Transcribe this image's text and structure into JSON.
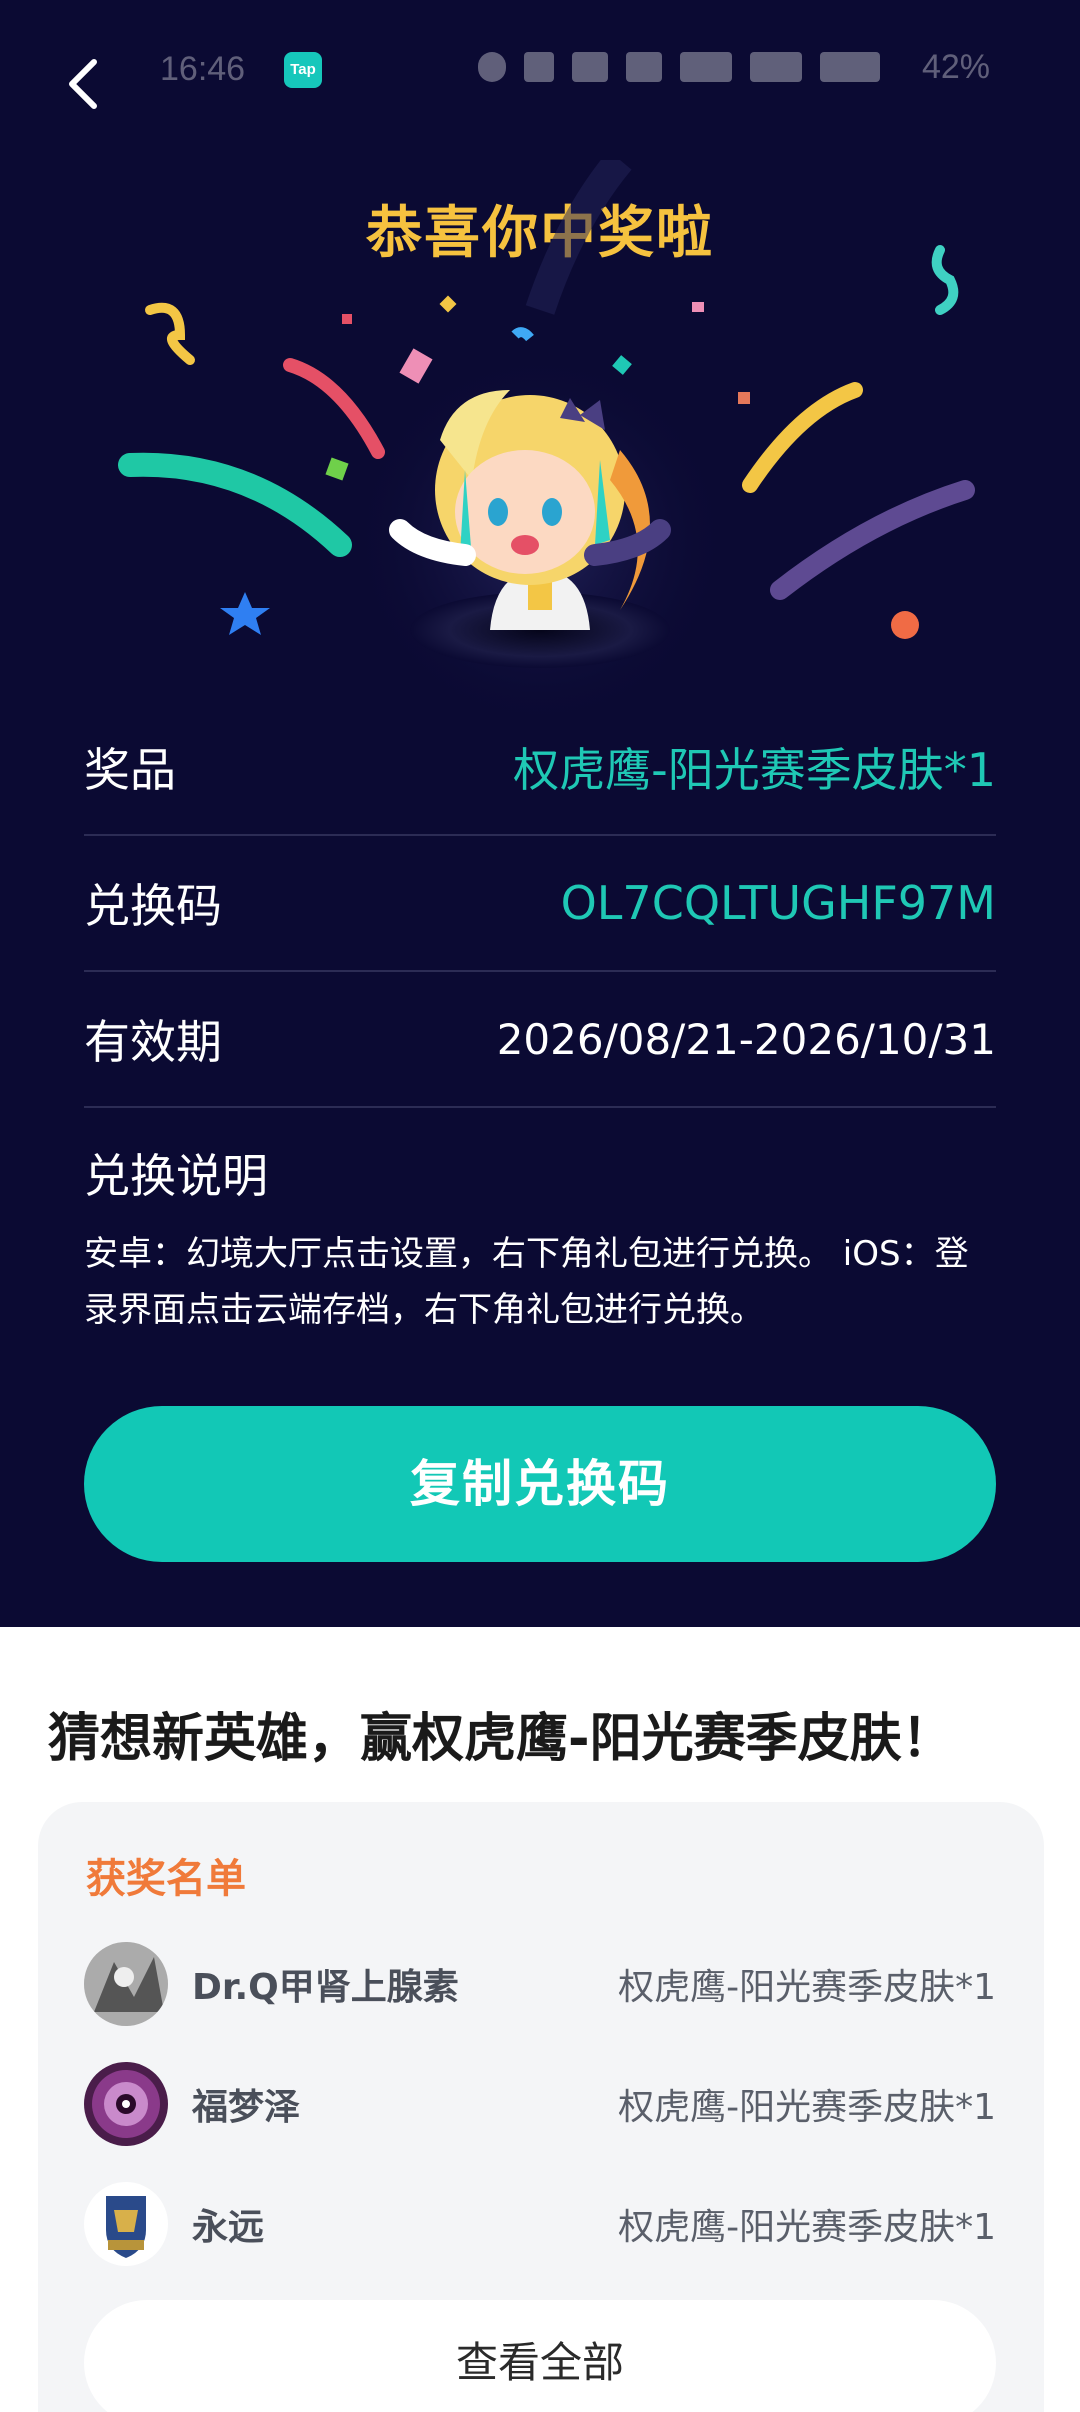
{
  "status_bar": {
    "time": "16:46",
    "app_badge": "Tap",
    "battery": "42%"
  },
  "header": {
    "title": "恭喜你中奖啦"
  },
  "prize_info": {
    "rows": [
      {
        "label": "奖品",
        "value": "权虎鹰-阳光赛季皮肤*1"
      },
      {
        "label": "兑换码",
        "value": "OL7CQLTUGHF97M"
      },
      {
        "label": "有效期",
        "value": "2026/08/21-2026/10/31"
      }
    ],
    "instructions_title": "兑换说明",
    "instructions_text": "安卓：幻境大厅点击设置，右下角礼包进行兑换。 iOS：登录界面点击云端存档，右下角礼包进行兑换。"
  },
  "copy_button": {
    "label": "复制兑换码"
  },
  "event": {
    "title": "猜想新英雄，赢权虎鹰-阳光赛季皮肤！",
    "winners_title": "获奖名单",
    "winners": [
      {
        "name": "Dr.Q甲肾上腺素",
        "prize": "权虎鹰-阳光赛季皮肤*1"
      },
      {
        "name": "福梦泽",
        "prize": "权虎鹰-阳光赛季皮肤*1"
      },
      {
        "name": "永远",
        "prize": "权虎鹰-阳光赛季皮肤*1"
      }
    ],
    "view_all_label": "查看全部"
  },
  "colors": {
    "dark_bg": "#0b0a33",
    "accent_teal": "#12c8b6",
    "title_gold": "#f6c23f",
    "winners_orange": "#f07a3a"
  }
}
